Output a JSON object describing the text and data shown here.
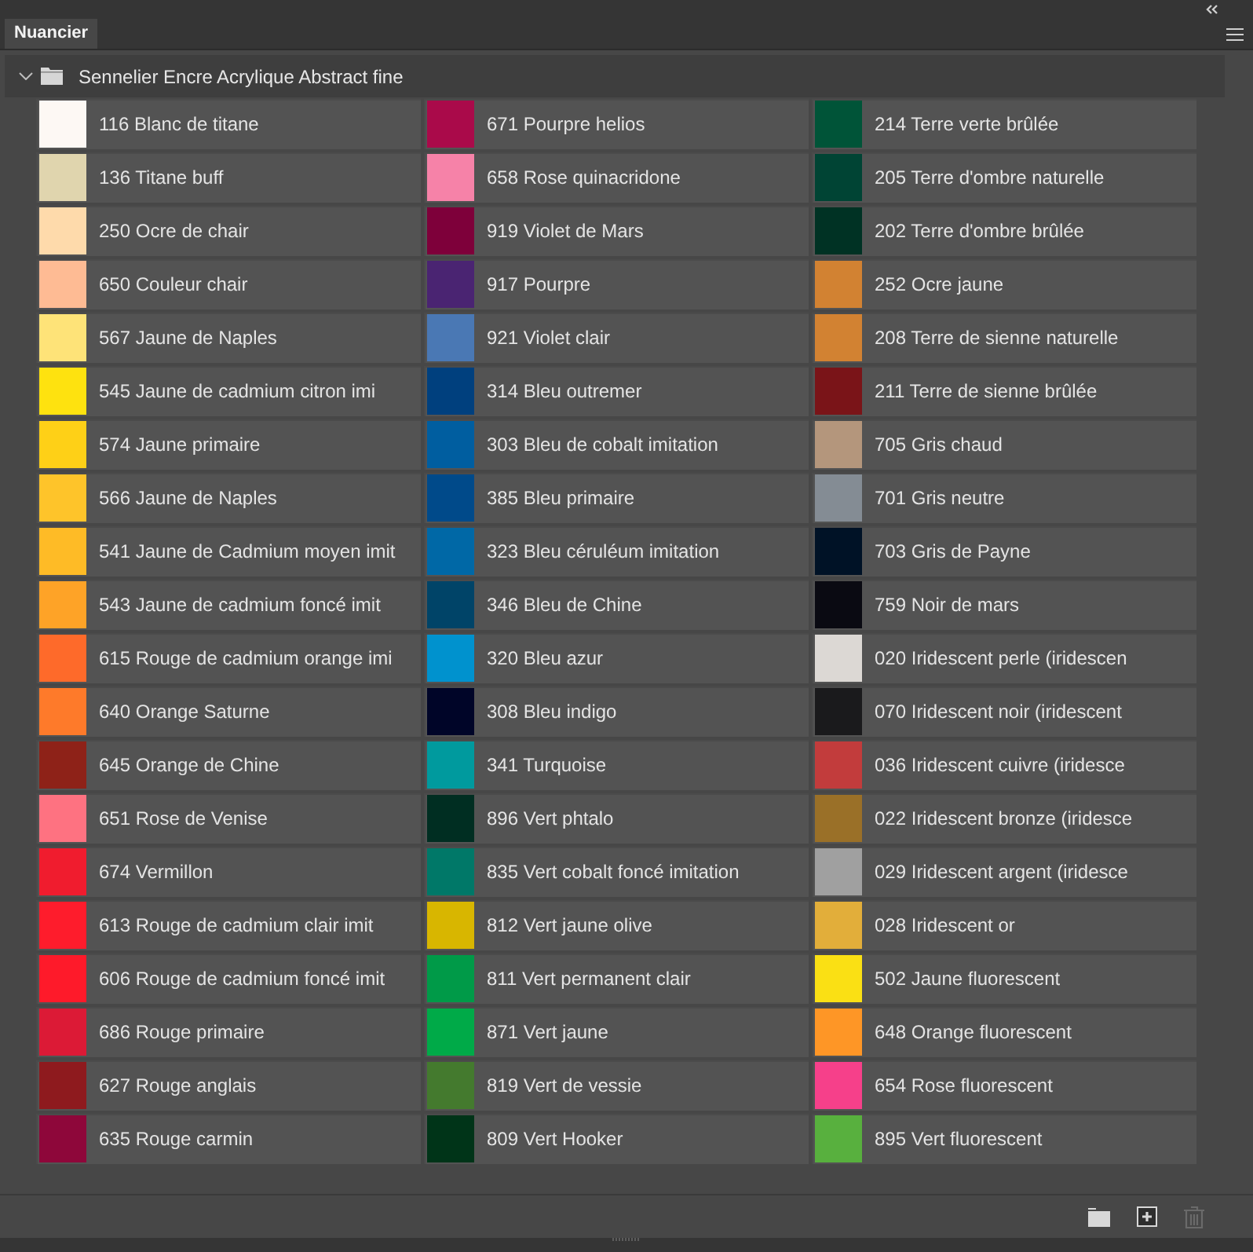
{
  "tabs": [
    {
      "label": "Nuancier",
      "selected": true
    }
  ],
  "group": {
    "name": "Sennelier Encre Acrylique Abstract fine",
    "expanded": true,
    "swatches": [
      {
        "name": "116 Blanc de titane",
        "color": "#fdf8f4"
      },
      {
        "name": "136 Titane buff",
        "color": "#e0d5ae"
      },
      {
        "name": "250 Ocre de chair",
        "color": "#fedaab"
      },
      {
        "name": "650 Couleur chair",
        "color": "#febb94"
      },
      {
        "name": "567 Jaune de Naples",
        "color": "#fee378"
      },
      {
        "name": "545 Jaune de cadmium citron imi",
        "color": "#fee20f"
      },
      {
        "name": "574 Jaune primaire",
        "color": "#fed017"
      },
      {
        "name": "566 Jaune de Naples",
        "color": "#fec42a"
      },
      {
        "name": "541 Jaune de Cadmium moyen imit",
        "color": "#febb26"
      },
      {
        "name": "543 Jaune de cadmium foncé imit",
        "color": "#fea327"
      },
      {
        "name": "615 Rouge de cadmium orange imi",
        "color": "#fe6a2a"
      },
      {
        "name": "640 Orange Saturne",
        "color": "#fe7a2a"
      },
      {
        "name": "645 Orange de Chine",
        "color": "#8e2218"
      },
      {
        "name": "651 Rose de Venise",
        "color": "#fe7281"
      },
      {
        "name": "674 Vermillon",
        "color": "#f01c2e"
      },
      {
        "name": "613 Rouge de cadmium clair imit",
        "color": "#fe1c2c"
      },
      {
        "name": "606 Rouge de cadmium foncé imit",
        "color": "#fe1a2a"
      },
      {
        "name": "686 Rouge primaire",
        "color": "#dc1a36"
      },
      {
        "name": "627 Rouge anglais",
        "color": "#8e1a1e"
      },
      {
        "name": "635 Rouge carmin",
        "color": "#8e073a"
      },
      {
        "name": "671 Pourpre helios",
        "color": "#aa0a4a"
      },
      {
        "name": "658 Rose quinacridone",
        "color": "#f682a8"
      },
      {
        "name": "919 Violet de Mars",
        "color": "#7e003a"
      },
      {
        "name": "917 Pourpre",
        "color": "#4a2472"
      },
      {
        "name": "921 Violet clair",
        "color": "#4a78b4"
      },
      {
        "name": "314 Bleu outremer",
        "color": "#00407e"
      },
      {
        "name": "303 Bleu de cobalt imitation",
        "color": "#005ea0"
      },
      {
        "name": "385 Bleu primaire",
        "color": "#004a8a"
      },
      {
        "name": "323 Bleu céruléum imitation",
        "color": "#0068a6"
      },
      {
        "name": "346 Bleu de Chine",
        "color": "#004468"
      },
      {
        "name": "320 Bleu azur",
        "color": "#0092ce"
      },
      {
        "name": "308 Bleu indigo",
        "color": "#000528"
      },
      {
        "name": "341 Turquoise",
        "color": "#009a9e"
      },
      {
        "name": "896 Vert phtalo",
        "color": "#002e22"
      },
      {
        "name": "835 Vert cobalt foncé imitation",
        "color": "#007868"
      },
      {
        "name": "812 Vert jaune olive",
        "color": "#d8b600"
      },
      {
        "name": "811 Vert permanent clair",
        "color": "#009a48"
      },
      {
        "name": "871 Vert jaune",
        "color": "#00aa48"
      },
      {
        "name": "819 Vert de vessie",
        "color": "#447a2e"
      },
      {
        "name": "809 Vert Hooker",
        "color": "#003418"
      },
      {
        "name": "214 Terre verte brûlée",
        "color": "#005438"
      },
      {
        "name": "205 Terre d'ombre naturelle",
        "color": "#004434"
      },
      {
        "name": "202 Terre d'ombre brûlée",
        "color": "#003224"
      },
      {
        "name": "252 Ocre jaune",
        "color": "#d28232"
      },
      {
        "name": "208 Terre de sienne naturelle",
        "color": "#d28232"
      },
      {
        "name": "211 Terre de sienne brûlée",
        "color": "#7a1418"
      },
      {
        "name": "705 Gris chaud",
        "color": "#b4967c"
      },
      {
        "name": "701 Gris neutre",
        "color": "#848c94"
      },
      {
        "name": "703 Gris de Payne",
        "color": "#001226"
      },
      {
        "name": "759 Noir de mars",
        "color": "#0a0a12"
      },
      {
        "name": "020 Iridescent perle (iridescen",
        "color": "#dcd8d4"
      },
      {
        "name": "070 Iridescent noir (iridescent",
        "color": "#1a1a1c"
      },
      {
        "name": "036 Iridescent cuivre (iridesce",
        "color": "#c23c3c"
      },
      {
        "name": "022 Iridescent bronze (iridesce",
        "color": "#9a7028"
      },
      {
        "name": "029 Iridescent argent (iridesce",
        "color": "#a0a0a0"
      },
      {
        "name": "028 Iridescent or",
        "color": "#e2ae3a"
      },
      {
        "name": "502 Jaune fluorescent",
        "color": "#fae014"
      },
      {
        "name": "648 Orange fluorescent",
        "color": "#fe9626"
      },
      {
        "name": "654 Rose fluorescent",
        "color": "#f6408a"
      },
      {
        "name": "895 Vert fluorescent",
        "color": "#58b03e"
      }
    ]
  },
  "toolbar": [
    {
      "kind": "new-group",
      "disabled": false
    },
    {
      "kind": "new-swatch",
      "disabled": false
    },
    {
      "kind": "delete",
      "disabled": true
    }
  ]
}
